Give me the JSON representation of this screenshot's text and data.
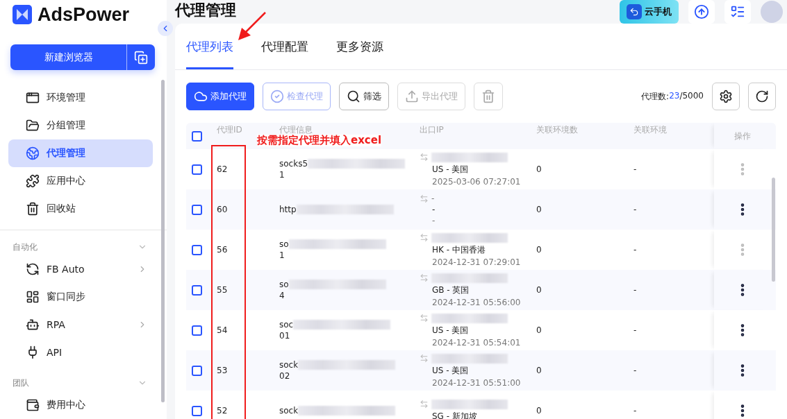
{
  "brand": "AdsPower",
  "new_browser": "新建浏览器",
  "nav": [
    {
      "label": "环境管理",
      "selected": false
    },
    {
      "label": "分组管理",
      "selected": false
    },
    {
      "label": "代理管理",
      "selected": true
    },
    {
      "label": "应用中心",
      "selected": false
    },
    {
      "label": "回收站",
      "selected": false
    }
  ],
  "sections": [
    {
      "title": "自动化",
      "expanded": true,
      "items": [
        {
          "label": "FB Auto",
          "has_submenu": true
        },
        {
          "label": "窗口同步",
          "has_submenu": false
        },
        {
          "label": "RPA",
          "has_submenu": true
        },
        {
          "label": "API",
          "has_submenu": false
        }
      ]
    },
    {
      "title": "团队",
      "expanded": true,
      "items": [
        {
          "label": "费用中心",
          "has_submenu": false
        }
      ]
    }
  ],
  "page_title": "代理管理",
  "cloud_phone": "云手机",
  "tabs": [
    {
      "label": "代理列表",
      "selected": true
    },
    {
      "label": "代理配置",
      "selected": false
    },
    {
      "label": "更多资源",
      "selected": false
    }
  ],
  "toolbar": [
    {
      "label": "添加代理",
      "kind": "primary"
    },
    {
      "label": "检查代理",
      "kind": "outline"
    },
    {
      "label": "筛选",
      "kind": "plain"
    },
    {
      "label": "导出代理",
      "kind": "disabled"
    },
    {
      "kind": "disabled"
    }
  ],
  "proxy_count": {
    "label": "代理数:",
    "count": "23",
    "total": "/5000"
  },
  "select_all_checked": false,
  "columns": [
    "代理ID",
    "代理信息",
    "出口IP",
    "关联环境数",
    "关联环境",
    "操作"
  ],
  "rows": [
    {
      "checked": false,
      "id": "62",
      "info": "socks5",
      "info_line2": "1",
      "region": "US - 美国",
      "time": "2025-03-06 07:27:01",
      "count": "0",
      "env": "-",
      "menu_disabled": true
    },
    {
      "checked": false,
      "id": "60",
      "info": "http",
      "ip": "-",
      "region": "-",
      "time": "-",
      "count": "0",
      "env": "-",
      "menu_disabled": false
    },
    {
      "checked": false,
      "id": "56",
      "info": "so",
      "info_line2": "1",
      "region": "HK - 中国香港",
      "time": "2024-12-31 07:29:01",
      "count": "0",
      "env": "-",
      "menu_disabled": true
    },
    {
      "checked": false,
      "id": "55",
      "info": "so",
      "info_line2": "4",
      "region": "GB - 英国",
      "time": "2024-12-31 05:56:00",
      "count": "0",
      "env": "-",
      "menu_disabled": false
    },
    {
      "checked": false,
      "id": "54",
      "info": "soc",
      "info_line2": "01",
      "region": "US - 美国",
      "time": "2024-12-31 05:54:01",
      "count": "0",
      "env": "-",
      "menu_disabled": false
    },
    {
      "checked": false,
      "id": "53",
      "info": "sock",
      "info_line2": "02",
      "region": "US - 美国",
      "time": "2024-12-31 05:51:00",
      "count": "0",
      "env": "-",
      "menu_disabled": false
    },
    {
      "checked": false,
      "id": "52",
      "info": "sock",
      "region": "SG - 新加坡",
      "count": "0",
      "env": "-",
      "menu_disabled": false
    }
  ],
  "annotation": "按需指定代理并填入excel"
}
